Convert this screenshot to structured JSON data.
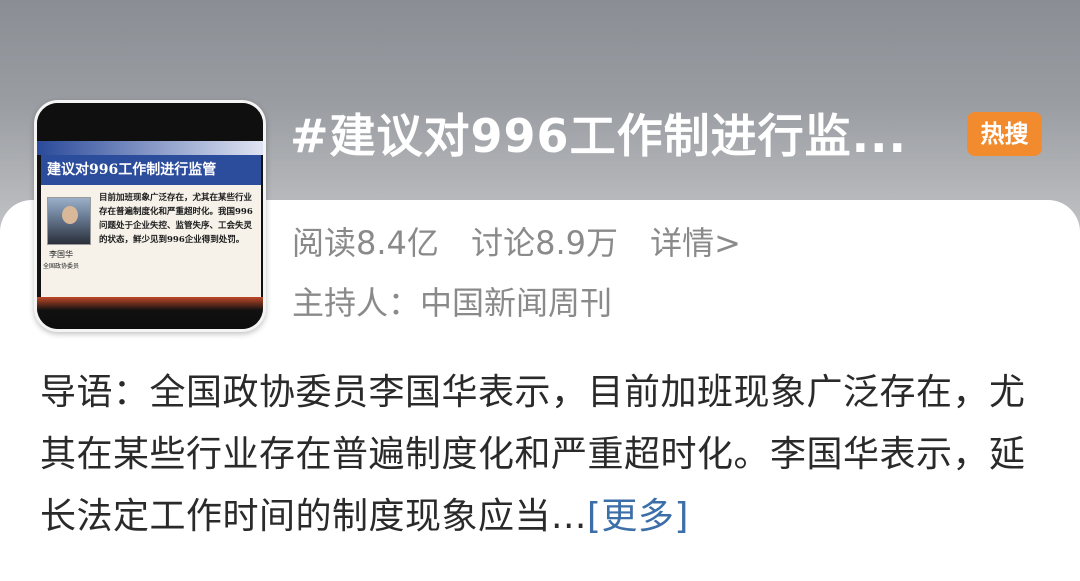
{
  "topic": {
    "title": "#建议对996工作制进行监...",
    "badge": "热搜"
  },
  "cover": {
    "banner": "建议对996工作制进行监管",
    "text": "目前加班现象广泛存在，尤其在某些行业存在普遍制度化和严重超时化。我国996问题处于企业失控、监管失序、工会失灵的状态，鲜少见到996企业得到处罚。",
    "name": "李国华",
    "role": "全国政协委员"
  },
  "stats": {
    "reads": "阅读8.4亿",
    "discussions": "讨论8.9万",
    "detail_link": "详情>"
  },
  "host": {
    "label": "主持人：中国新闻周刊"
  },
  "intro": {
    "text": "导语：全国政协委员李国华表示，目前加班现象广泛存在，尤其在某些行业存在普遍制度化和严重超时化。李国华表示，延长法定工作时间的制度现象应当...",
    "more_link": "[更多]"
  },
  "colors": {
    "badge": "#f28a2e",
    "link": "#3c6ea8",
    "meta_text": "#8a8a8a"
  }
}
